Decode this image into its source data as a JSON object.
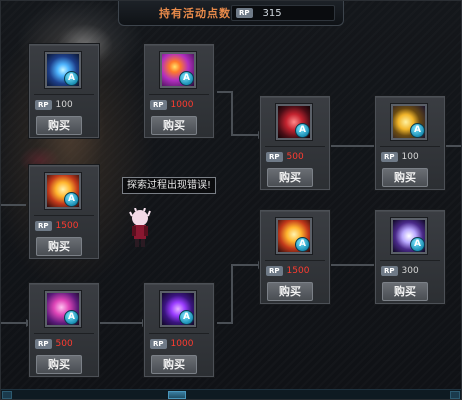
{
  "header": {
    "title": "持有活动点数",
    "currency_badge": "RP",
    "points": "315"
  },
  "tooltip": "探索过程出现错误!",
  "buy_label": "购买",
  "currency_badge": "RP",
  "items": [
    {
      "id": "a1",
      "price": "100",
      "price_color": "white",
      "icon": "blue-aura-skill-icon"
    },
    {
      "id": "a2",
      "price": "1000",
      "price_color": "red",
      "icon": "purple-flame-skill-icon"
    },
    {
      "id": "a3",
      "price": "1500",
      "price_color": "red",
      "icon": "golden-flame-skill-icon"
    },
    {
      "id": "a4",
      "price": "500",
      "price_color": "red",
      "icon": "magenta-swirl-skill-icon"
    },
    {
      "id": "a5",
      "price": "1000",
      "price_color": "red",
      "icon": "violet-burst-skill-icon"
    },
    {
      "id": "b1",
      "price": "500",
      "price_color": "red",
      "icon": "red-scythe-skill-icon"
    },
    {
      "id": "b2",
      "price": "100",
      "price_color": "white",
      "icon": "gold-ring-skill-icon"
    },
    {
      "id": "b3",
      "price": "1500",
      "price_color": "red",
      "icon": "golden-flame-skill-icon"
    },
    {
      "id": "b4",
      "price": "300",
      "price_color": "white",
      "icon": "silver-blade-skill-icon"
    }
  ],
  "grade_letter": "A",
  "colors": {
    "header_title": "#e88a4a",
    "price_red": "#ff3b30",
    "price_white": "#d6d6d6",
    "grade_badge": "#1b8fb5"
  }
}
